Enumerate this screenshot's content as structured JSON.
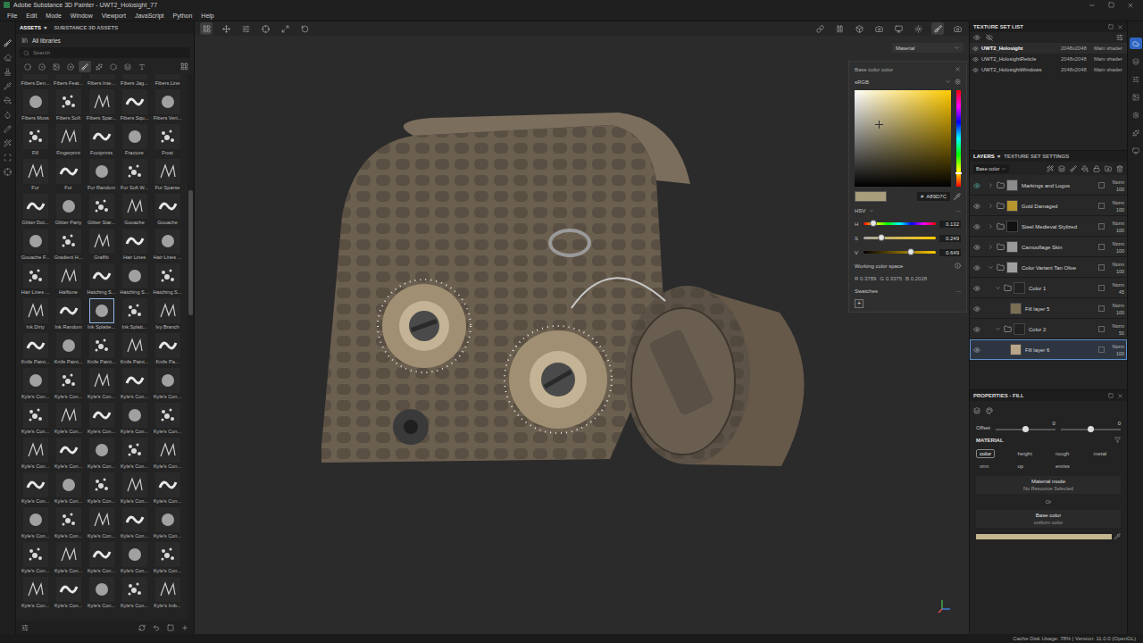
{
  "window": {
    "title": "Adobe Substance 3D Painter - UWT2_Holosight_77"
  },
  "menu": [
    "File",
    "Edit",
    "Mode",
    "Window",
    "Viewport",
    "JavaScript",
    "Python",
    "Help"
  ],
  "assets": {
    "tabs": [
      {
        "label": "ASSETS",
        "selected": true,
        "closable": true
      },
      {
        "label": "SUBSTANCE 3D ASSETS",
        "selected": false,
        "closable": false
      }
    ],
    "close": "×",
    "library": "All libraries",
    "search_placeholder": "Search",
    "filters": [
      {
        "kind": "sphere",
        "selected": false
      },
      {
        "kind": "smart",
        "selected": false
      },
      {
        "kind": "texture",
        "selected": false
      },
      {
        "kind": "mask",
        "selected": false
      },
      {
        "kind": "brush",
        "selected": true
      },
      {
        "kind": "particle",
        "selected": false
      },
      {
        "kind": "pattern",
        "selected": false
      },
      {
        "kind": "stencil",
        "selected": false
      },
      {
        "kind": "text",
        "selected": false
      }
    ],
    "brushes": [
      {
        "label": "Fibers Den...",
        "selected": false
      },
      {
        "label": "Fibers Feat...",
        "selected": false
      },
      {
        "label": "Fibers Inte...",
        "selected": false
      },
      {
        "label": "Fibers Jag...",
        "selected": false
      },
      {
        "label": "Fibers Line",
        "selected": false
      },
      {
        "label": "Fibers Moss",
        "selected": false
      },
      {
        "label": "Fibers Soft",
        "selected": false
      },
      {
        "label": "Fibers Spar...",
        "selected": false
      },
      {
        "label": "Fibers Squ...",
        "selected": false
      },
      {
        "label": "Fibers Vert...",
        "selected": false
      },
      {
        "label": "Fill",
        "selected": false
      },
      {
        "label": "Fingerprint",
        "selected": false
      },
      {
        "label": "Footprints",
        "selected": false
      },
      {
        "label": "Fracture",
        "selected": false
      },
      {
        "label": "Frost",
        "selected": false
      },
      {
        "label": "Fur",
        "selected": false
      },
      {
        "label": "Fur",
        "selected": false
      },
      {
        "label": "Fur Random",
        "selected": false
      },
      {
        "label": "Fur Soft W...",
        "selected": false
      },
      {
        "label": "Fur Sparse",
        "selected": false
      },
      {
        "label": "Glitter Dot...",
        "selected": false
      },
      {
        "label": "Glitter Party",
        "selected": false
      },
      {
        "label": "Glitter Star...",
        "selected": false
      },
      {
        "label": "Gouache",
        "selected": false
      },
      {
        "label": "Gouache",
        "selected": false
      },
      {
        "label": "Gouache F...",
        "selected": false
      },
      {
        "label": "Gradient H...",
        "selected": false
      },
      {
        "label": "Graffiti",
        "selected": false
      },
      {
        "label": "Hair Lines",
        "selected": false
      },
      {
        "label": "Hair Lines ...",
        "selected": false
      },
      {
        "label": "Hair Lines ...",
        "selected": false
      },
      {
        "label": "Halftone",
        "selected": false
      },
      {
        "label": "Hatching S...",
        "selected": false
      },
      {
        "label": "Hatching S...",
        "selected": false
      },
      {
        "label": "Hatching S...",
        "selected": false
      },
      {
        "label": "Ink Dirty",
        "selected": false
      },
      {
        "label": "Ink Random",
        "selected": false
      },
      {
        "label": "Ink Splatte...",
        "selected": true
      },
      {
        "label": "Ink Splatt...",
        "selected": false
      },
      {
        "label": "Ivy Branch",
        "selected": false
      },
      {
        "label": "Knife Paint...",
        "selected": false
      },
      {
        "label": "Knife Paint...",
        "selected": false
      },
      {
        "label": "Knife Paint...",
        "selected": false
      },
      {
        "label": "Knife Paint...",
        "selected": false
      },
      {
        "label": "Knife Pa...",
        "selected": false
      },
      {
        "label": "Kyle's Con...",
        "selected": false
      },
      {
        "label": "Kyle's Con...",
        "selected": false
      },
      {
        "label": "Kyle's Con...",
        "selected": false
      },
      {
        "label": "Kyle's Con...",
        "selected": false
      },
      {
        "label": "Kyle's Con...",
        "selected": false
      },
      {
        "label": "Kyle's Con...",
        "selected": false
      },
      {
        "label": "Kyle's Con...",
        "selected": false
      },
      {
        "label": "Kyle's Con...",
        "selected": false
      },
      {
        "label": "Kyle's Con...",
        "selected": false
      },
      {
        "label": "Kyle's Con...",
        "selected": false
      },
      {
        "label": "Kyle's Con...",
        "selected": false
      },
      {
        "label": "Kyle's Con...",
        "selected": false
      },
      {
        "label": "Kyle's Con...",
        "selected": false
      },
      {
        "label": "Kyle's Con...",
        "selected": false
      },
      {
        "label": "Kyle's Con...",
        "selected": false
      },
      {
        "label": "Kyle's Con...",
        "selected": false
      },
      {
        "label": "Kyle's Con...",
        "selected": false
      },
      {
        "label": "Kyle's Con...",
        "selected": false
      },
      {
        "label": "Kyle's Con...",
        "selected": false
      },
      {
        "label": "Kyle's Con...",
        "selected": false
      },
      {
        "label": "Kyle's Con...",
        "selected": false
      },
      {
        "label": "Kyle's Con...",
        "selected": false
      },
      {
        "label": "Kyle's Con...",
        "selected": false
      },
      {
        "label": "Kyle's Con...",
        "selected": false
      },
      {
        "label": "Kyle's Con...",
        "selected": false
      },
      {
        "label": "Kyle's Con...",
        "selected": false
      },
      {
        "label": "Kyle's Con...",
        "selected": false
      },
      {
        "label": "Kyle's Con...",
        "selected": false
      },
      {
        "label": "Kyle's Con...",
        "selected": false
      },
      {
        "label": "Kyle's Con...",
        "selected": false
      },
      {
        "label": "Kyle's Con...",
        "selected": false
      },
      {
        "label": "Kyle's Con...",
        "selected": false
      },
      {
        "label": "Kyle's Con...",
        "selected": false
      },
      {
        "label": "Kyle's Con...",
        "selected": false
      },
      {
        "label": "Kyle's Imb...",
        "selected": false
      }
    ]
  },
  "viewport": {
    "mode": "Material"
  },
  "color_picker": {
    "title": "Base color color",
    "space": "sRGB",
    "hex_prefix": "#",
    "hex": "A89D7C",
    "model": "HSV",
    "more": "···",
    "sliders": [
      {
        "label": "H",
        "value": "0.132",
        "level": 0.132
      },
      {
        "label": "S",
        "value": "0.249",
        "level": 0.249
      },
      {
        "label": "V",
        "value": "0.649",
        "level": 0.649
      }
    ],
    "working_space_label": "Working color space",
    "rgb": [
      "R 0.3789",
      "G 0.3375",
      "B 0.2028"
    ],
    "swatches_label": "Swatches",
    "add": "+"
  },
  "texture_sets": {
    "title": "TEXTURE SET LIST",
    "items": [
      {
        "name": "UWT2_Holosight",
        "size": "2048x2048",
        "shader": "Main shader",
        "selected": true,
        "visible": true
      },
      {
        "name": "UWT2_HolosightReticle",
        "size": "2048x2048",
        "shader": "Main shader",
        "selected": false,
        "visible": true
      },
      {
        "name": "UWT2_HolosightWindows",
        "size": "2048x2048",
        "shader": "Main shader",
        "selected": false,
        "visible": true
      }
    ]
  },
  "layers": {
    "tabs": [
      {
        "label": "LAYERS",
        "selected": true,
        "closable": true
      },
      {
        "label": "TEXTURE SET SETTINGS",
        "selected": false,
        "closable": false
      }
    ],
    "channel": "Base color",
    "rows": [
      {
        "name": "Markings and Logos",
        "kind": "folder",
        "indent": 0,
        "expanded": false,
        "blend": "Norm",
        "opacity": "100",
        "selected": false,
        "visible": true,
        "thumb": "#8c8c8c"
      },
      {
        "name": "Gold Damaged",
        "kind": "folder",
        "indent": 0,
        "expanded": false,
        "blend": "Norm",
        "opacity": "100",
        "selected": false,
        "visible": true,
        "thumb": "#b8962e"
      },
      {
        "name": "Steel Medieval Stylized",
        "kind": "folder",
        "indent": 0,
        "expanded": false,
        "blend": "Norm",
        "opacity": "100",
        "selected": false,
        "visible": true,
        "thumb": "#111111"
      },
      {
        "name": "Camouflage Skin",
        "kind": "folder",
        "indent": 0,
        "expanded": false,
        "blend": "Norm",
        "opacity": "100",
        "selected": false,
        "visible": true,
        "thumb": "#9a9a9a"
      },
      {
        "name": "Color Variant Tan Olive",
        "kind": "folder",
        "indent": 0,
        "expanded": true,
        "blend": "Norm",
        "opacity": "100",
        "selected": false,
        "visible": true,
        "thumb": "#a0a0a0"
      },
      {
        "name": "Color 1",
        "kind": "folder",
        "indent": 1,
        "expanded": true,
        "blend": "Norm",
        "opacity": "45",
        "selected": false,
        "visible": true,
        "thumb": "#222222"
      },
      {
        "name": "Fill layer 5",
        "kind": "fill",
        "indent": 2,
        "expanded": false,
        "blend": "Norm",
        "opacity": "100",
        "selected": false,
        "visible": true,
        "thumb": "#7a6f55"
      },
      {
        "name": "Color 2",
        "kind": "folder",
        "indent": 1,
        "expanded": true,
        "blend": "Norm",
        "opacity": "50",
        "selected": false,
        "visible": true,
        "thumb": "#222222"
      },
      {
        "name": "Fill layer 6",
        "kind": "fill",
        "indent": 2,
        "expanded": false,
        "blend": "Norm",
        "opacity": "100",
        "selected": true,
        "visible": true,
        "thumb": "#b8a58a"
      }
    ]
  },
  "properties": {
    "title": "PROPERTIES - FILL",
    "offset": {
      "label": "Offset",
      "values": [
        {
          "value": "0",
          "level": 0.5
        },
        {
          "value": "0",
          "level": 0.5
        }
      ]
    },
    "material": {
      "title": "MATERIAL",
      "channels": [
        {
          "label": "color",
          "selected": true
        },
        {
          "label": "height",
          "selected": false
        },
        {
          "label": "rough",
          "selected": false
        },
        {
          "label": "metal",
          "selected": false
        },
        {
          "label": "nrm",
          "selected": false
        },
        {
          "label": "op",
          "selected": false
        },
        {
          "label": "emiss",
          "selected": false
        }
      ],
      "mode_title": "Material mode",
      "mode_value": "No Resource Selected",
      "or": "Or",
      "base_title": "Base color",
      "base_value": "uniform color",
      "base_swatch": "#c4b68f"
    }
  },
  "status_bar": "Cache Disk Usage:  78% | Version: 11.0.0 (OpenGL)"
}
